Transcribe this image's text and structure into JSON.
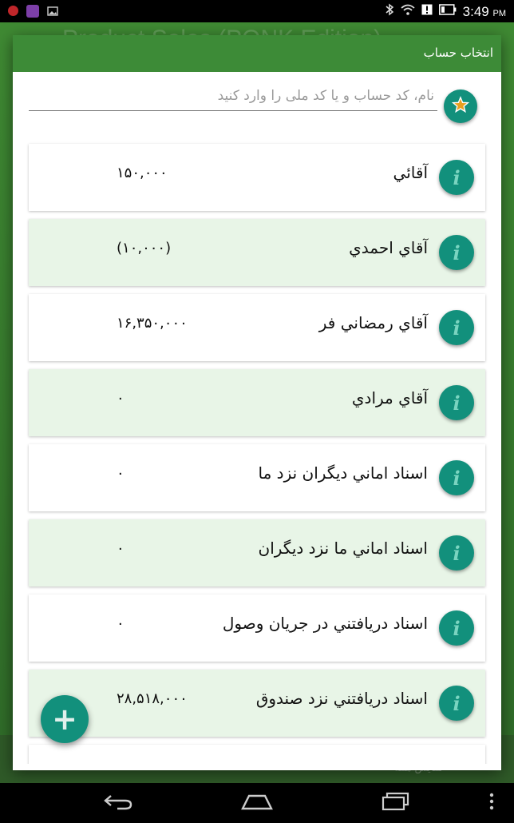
{
  "status_bar": {
    "time": "3:49",
    "time_suffix": "PM",
    "icons": [
      "app-notification-icon",
      "purple-app-icon",
      "image-icon",
      "bluetooth-icon",
      "wifi-icon",
      "alert-icon",
      "battery-icon"
    ]
  },
  "background_app": {
    "title": "Product Sales (PONK Edition)",
    "show_all": "نمایش همه"
  },
  "dialog": {
    "title": "انتخاب حساب",
    "search_placeholder": "نام، کد حساب و یا کد ملی را وارد کنید",
    "search_value": ""
  },
  "accounts": [
    {
      "name": "آقائي",
      "amount": "۱۵۰,۰۰۰"
    },
    {
      "name": "آقاي احمدي",
      "amount": "(۱۰,۰۰۰)"
    },
    {
      "name": "آقاي رمضاني فر",
      "amount": "۱۶,۳۵۰,۰۰۰"
    },
    {
      "name": "آقاي مرادي",
      "amount": "۰"
    },
    {
      "name": "اسناد اماني ديگران نزد ما",
      "amount": "۰"
    },
    {
      "name": "اسناد اماني ما نزد ديگران",
      "amount": "۰"
    },
    {
      "name": "اسناد دريافتني در جريان وصول",
      "amount": "۰"
    },
    {
      "name": "اسناد دريافتني نزد صندوق",
      "amount": "۲۸,۵۱۸,۰۰۰"
    }
  ],
  "fab": {
    "label": "+"
  },
  "colors": {
    "accent": "#12907c",
    "header": "#3d8b37",
    "row_alt": "#e8f5e7"
  }
}
